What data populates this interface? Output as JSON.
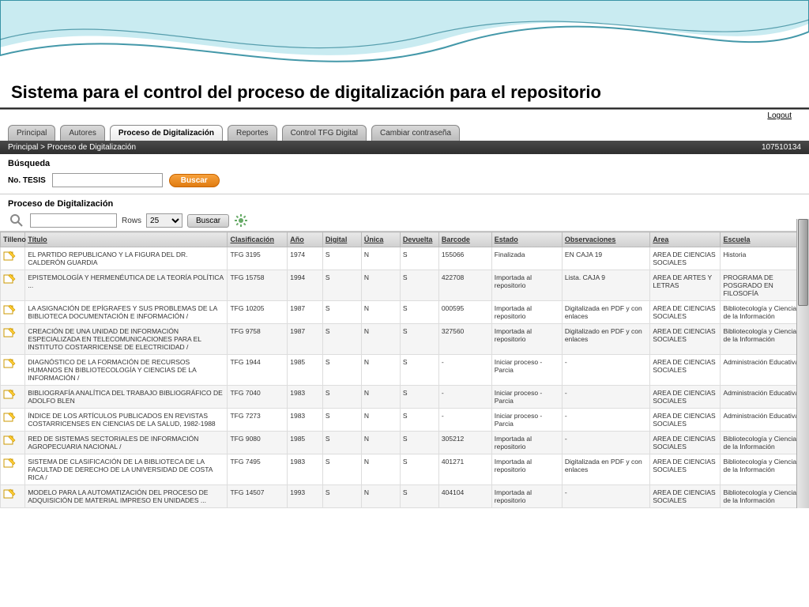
{
  "page_title": "Sistema para el control del proceso de digitalización para el repositorio",
  "logout": "Logout",
  "tabs": [
    "Principal",
    "Autores",
    "Proceso de Digitalización",
    "Reportes",
    "Control TFG Digital",
    "Cambiar contraseña"
  ],
  "active_tab_index": 2,
  "breadcrumb": "Principal > Proceso de Digitalización",
  "user_id": "107510134",
  "search_section_label": "Búsqueda",
  "search_field_label": "No. TESIS",
  "search_button": "Buscar",
  "process_section_label": "Proceso de Digitalización",
  "toolbar": {
    "rows_label": "Rows",
    "rows_value": "25",
    "search_button": "Buscar"
  },
  "columns": [
    "Tilleno",
    "Título",
    "Clasificación",
    "Año",
    "Digital",
    "Única",
    "Devuelta",
    "Barcode",
    "Estado",
    "Observaciones",
    "Area",
    "Escuela"
  ],
  "rows": [
    {
      "titulo": "EL PARTIDO REPUBLICANO Y LA FIGURA DEL DR. CALDERÓN GUARDIA",
      "clas": "TFG 3195",
      "ano": "1974",
      "dig": "S",
      "uni": "N",
      "dev": "S",
      "bar": "155066",
      "estado": "Finalizada",
      "obs": "EN CAJA 19",
      "area": "AREA DE CIENCIAS SOCIALES",
      "escuela": "Historia"
    },
    {
      "titulo": "EPISTEMOLOGÍA Y HERMENÉUTICA DE LA TEORÍA POLÍTICA ...",
      "clas": "TFG 15758",
      "ano": "1994",
      "dig": "S",
      "uni": "N",
      "dev": "S",
      "bar": "422708",
      "estado": "Importada al repositorio",
      "obs": "Lista. CAJA 9",
      "area": "AREA DE ARTES Y LETRAS",
      "escuela": "PROGRAMA DE POSGRADO EN FILOSOFÍA"
    },
    {
      "titulo": "LA ASIGNACIÓN DE EPÍGRAFES Y SUS PROBLEMAS DE LA BIBLIOTECA DOCUMENTACIÓN E INFORMACIÓN /",
      "clas": "TFG 10205",
      "ano": "1987",
      "dig": "S",
      "uni": "N",
      "dev": "S",
      "bar": "000595",
      "estado": "Importada al repositorio",
      "obs": "Digitalizada en PDF y con enlaces",
      "area": "AREA DE CIENCIAS SOCIALES",
      "escuela": "Bibliotecología y Ciencias de la Información"
    },
    {
      "titulo": "CREACIÓN DE UNA UNIDAD DE INFORMACIÓN ESPECIALIZADA EN TELECOMUNICACIONES PARA EL INSTITUTO COSTARRICENSE DE ELECTRICIDAD /",
      "clas": "TFG 9758",
      "ano": "1987",
      "dig": "S",
      "uni": "N",
      "dev": "S",
      "bar": "327560",
      "estado": "Importada al repositorio",
      "obs": "Digitalizado en PDF y con enlaces",
      "area": "AREA DE CIENCIAS SOCIALES",
      "escuela": "Bibliotecología y Ciencias de la Información"
    },
    {
      "titulo": "DIAGNÓSTICO DE LA FORMACIÓN DE RECURSOS HUMANOS EN BIBLIOTECOLOGÍA Y CIENCIAS DE LA INFORMACIÓN /",
      "clas": "TFG 1944",
      "ano": "1985",
      "dig": "S",
      "uni": "N",
      "dev": "S",
      "bar": "-",
      "estado": "Iniciar proceso - Parcia",
      "obs": "-",
      "area": "AREA DE CIENCIAS SOCIALES",
      "escuela": "Administración Educativa"
    },
    {
      "titulo": "BIBLIOGRAFÍA ANALÍTICA DEL TRABAJO BIBLIOGRÁFICO DE ADOLFO BLEN",
      "clas": "TFG 7040",
      "ano": "1983",
      "dig": "S",
      "uni": "N",
      "dev": "S",
      "bar": "-",
      "estado": "Iniciar proceso - Parcia",
      "obs": "-",
      "area": "AREA DE CIENCIAS SOCIALES",
      "escuela": "Administración Educativa"
    },
    {
      "titulo": "ÍNDICE DE LOS ARTÍCULOS PUBLICADOS EN REVISTAS COSTARRICENSES EN CIENCIAS DE LA SALUD, 1982-1988",
      "clas": "TFG 7273",
      "ano": "1983",
      "dig": "S",
      "uni": "N",
      "dev": "S",
      "bar": "-",
      "estado": "Iniciar proceso - Parcia",
      "obs": "-",
      "area": "AREA DE CIENCIAS SOCIALES",
      "escuela": "Administración Educativa"
    },
    {
      "titulo": "RED DE SISTEMAS SECTORIALES DE INFORMACIÓN AGROPECUARIA NACIONAL /",
      "clas": "TFG 9080",
      "ano": "1985",
      "dig": "S",
      "uni": "N",
      "dev": "S",
      "bar": "305212",
      "estado": "Importada al repositorio",
      "obs": "-",
      "area": "AREA DE CIENCIAS SOCIALES",
      "escuela": "Bibliotecología y Ciencias de la Información"
    },
    {
      "titulo": "SISTEMA DE CLASIFICACIÓN DE LA BIBLIOTECA DE LA FACULTAD DE DERECHO DE LA UNIVERSIDAD DE COSTA RICA /",
      "clas": "TFG 7495",
      "ano": "1983",
      "dig": "S",
      "uni": "N",
      "dev": "S",
      "bar": "401271",
      "estado": "Importada al repositorio",
      "obs": "Digitalizada en PDF y con enlaces",
      "area": "AREA DE CIENCIAS SOCIALES",
      "escuela": "Bibliotecología y Ciencias de la Información"
    },
    {
      "titulo": "MODELO PARA LA AUTOMATIZACIÓN DEL PROCESO DE ADQUISICIÓN DE MATERIAL IMPRESO EN UNIDADES ...",
      "clas": "TFG 14507",
      "ano": "1993",
      "dig": "S",
      "uni": "N",
      "dev": "S",
      "bar": "404104",
      "estado": "Importada al repositorio",
      "obs": "-",
      "area": "AREA DE CIENCIAS SOCIALES",
      "escuela": "Bibliotecología y Ciencias de la Información"
    }
  ]
}
